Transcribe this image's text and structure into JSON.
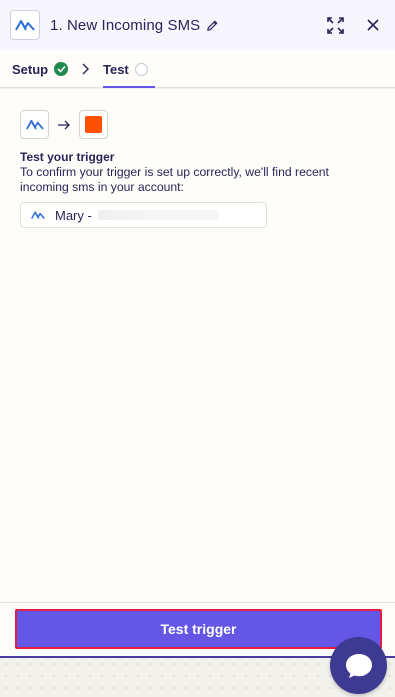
{
  "header": {
    "title": "1. New Incoming SMS",
    "icons": {
      "app": "app-logo-icon",
      "edit": "pencil-icon",
      "expand": "expand-icon",
      "close": "close-icon"
    }
  },
  "tabs": [
    {
      "label": "Setup",
      "status": "complete"
    },
    {
      "label": "Test",
      "status": "incomplete",
      "active": true
    }
  ],
  "content": {
    "test_title": "Test your trigger",
    "test_description": "To confirm your trigger is set up correctly, we'll find recent incoming sms in your account:",
    "record_label": "Mary -"
  },
  "footer": {
    "button_label": "Test trigger"
  },
  "colors": {
    "accent": "#6557e6",
    "success": "#1e8a4b",
    "destination_app": "#ff4f00",
    "chat": "#3d3a92",
    "highlight_border": "#e11d48"
  }
}
